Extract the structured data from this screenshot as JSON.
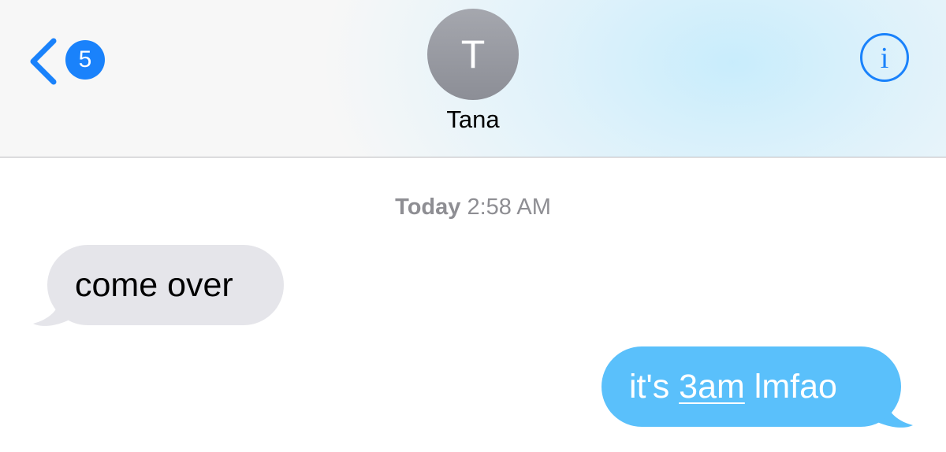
{
  "header": {
    "back_count": "5",
    "back_icon": "chevron-left-icon",
    "contact_initial": "T",
    "contact_name": "Tana",
    "info_icon": "info-icon"
  },
  "thread": {
    "timestamp": {
      "day": "Today",
      "time": "2:58 AM"
    },
    "messages": [
      {
        "direction": "incoming",
        "text": "come over"
      },
      {
        "direction": "outgoing",
        "parts": [
          "it's ",
          "3am",
          " lmfao"
        ],
        "link": "3am"
      }
    ]
  },
  "colors": {
    "accent": "#1a82fb",
    "incoming_bubble": "#e5e5ea",
    "outgoing_bubble": "#5ac0fb",
    "timestamp_text": "#8e8e93",
    "avatar": "#9a9ca3"
  }
}
